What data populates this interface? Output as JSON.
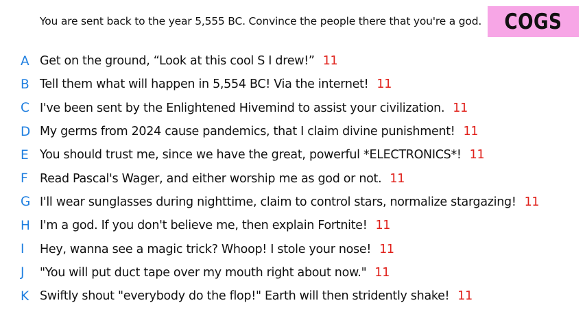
{
  "prompt": "You are sent back to the year 5,555 BC. Convince the people there that you're a god.",
  "badge": "COGS",
  "answers": [
    {
      "letter": "A",
      "text": "Get on the ground, “Look at this cool S I drew!”",
      "score": "11"
    },
    {
      "letter": "B",
      "text": "Tell them what will happen in 5,554 BC! Via the internet!",
      "score": "11"
    },
    {
      "letter": "C",
      "text": "I've been sent by the Enlightened Hivemind to assist your civilization.",
      "score": "11"
    },
    {
      "letter": "D",
      "text": "My germs from 2024 cause pandemics, that I claim divine punishment!",
      "score": "11"
    },
    {
      "letter": "E",
      "text": "You should trust me, since we have the great, powerful *ELECTRONICS*!",
      "score": "11"
    },
    {
      "letter": "F",
      "text": "Read Pascal's Wager, and either worship me as god or not.",
      "score": "11"
    },
    {
      "letter": "G",
      "text": "I'll wear sunglasses during nighttime, claim to control stars, normalize stargazing!",
      "score": "11"
    },
    {
      "letter": "H",
      "text": "I'm a god. If you don't believe me, then explain Fortnite!",
      "score": "11"
    },
    {
      "letter": "I",
      "text": "Hey, wanna see a magic trick? Whoop! I stole your nose!",
      "score": "11"
    },
    {
      "letter": "J",
      "text": "\"You will put duct tape over my mouth right about now.\"",
      "score": "11"
    },
    {
      "letter": "K",
      "text": "Swiftly shout \"everybody do the flop!\" Earth will then stridently shake!",
      "score": "11"
    }
  ],
  "colors": {
    "letter": "#1f7fe0",
    "score": "#e0201a",
    "badge_bg": "#f7a6e6"
  }
}
